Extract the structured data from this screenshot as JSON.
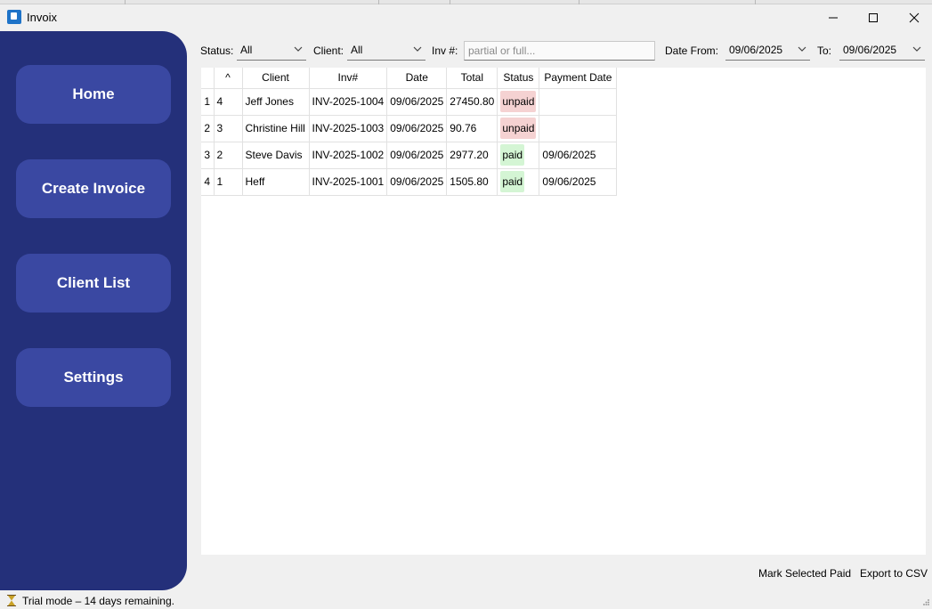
{
  "window": {
    "title": "Invoix",
    "icons": {
      "app": "invoix-logo-icon",
      "minimize": "minimize-icon",
      "maximize": "maximize-icon",
      "close": "close-icon"
    }
  },
  "sidebar": {
    "color": "#24307a",
    "button_color": "#3a48a2",
    "items": [
      {
        "label": "Home"
      },
      {
        "label": "Create Invoice"
      },
      {
        "label": "Client List"
      },
      {
        "label": "Settings"
      }
    ]
  },
  "filters": {
    "status_label": "Status:",
    "status_value": "All",
    "client_label": "Client:",
    "client_value": "All",
    "inv_label": "Inv #:",
    "inv_placeholder": "partial or full...",
    "date_from_label": "Date From:",
    "date_from_value": "09/06/2025",
    "to_label": "To:",
    "to_value": "09/06/2025"
  },
  "table": {
    "columns": [
      "^",
      "Client",
      "Inv#",
      "Date",
      "Total",
      "Status",
      "Payment Date"
    ],
    "status_colors": {
      "paid": "#d4f5d4",
      "unpaid": "#f5d2d2"
    },
    "rows": [
      {
        "row": "1",
        "id": "4",
        "client": "Jeff Jones",
        "inv": "INV-2025-1004",
        "date": "09/06/2025",
        "total": "27450.80",
        "status": "unpaid",
        "payment_date": ""
      },
      {
        "row": "2",
        "id": "3",
        "client": "Christine Hill",
        "inv": "INV-2025-1003",
        "date": "09/06/2025",
        "total": "90.76",
        "status": "unpaid",
        "payment_date": ""
      },
      {
        "row": "3",
        "id": "2",
        "client": "Steve Davis",
        "inv": "INV-2025-1002",
        "date": "09/06/2025",
        "total": "2977.20",
        "status": "paid",
        "payment_date": "09/06/2025"
      },
      {
        "row": "4",
        "id": "1",
        "client": "Heff",
        "inv": "INV-2025-1001",
        "date": "09/06/2025",
        "total": "1505.80",
        "status": "paid",
        "payment_date": "09/06/2025"
      }
    ]
  },
  "actions": {
    "mark_paid": "Mark Selected Paid",
    "export_csv": "Export to CSV"
  },
  "statusbar": {
    "icon": "hourglass-icon",
    "text": "Trial mode – 14 days remaining."
  }
}
